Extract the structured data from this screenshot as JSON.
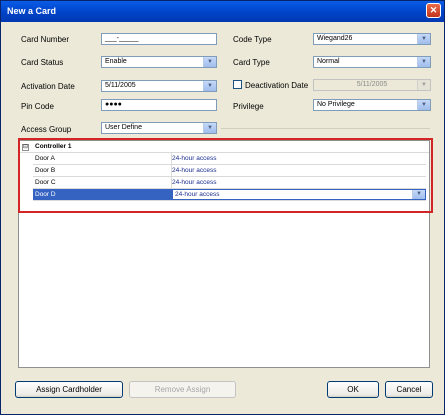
{
  "window": {
    "title": "New a Card",
    "close_glyph": "✕"
  },
  "form": {
    "card_number": {
      "label": "Card Number",
      "value": "___-_____"
    },
    "card_status": {
      "label": "Card Status",
      "value": "Enable"
    },
    "activation_date": {
      "label": "Activation Date",
      "value": "5/11/2005"
    },
    "pin_code": {
      "label": "Pin Code",
      "value": "●●●●"
    },
    "access_group": {
      "label": "Access Group",
      "value": "User Define"
    },
    "code_type": {
      "label": "Code Type",
      "value": "Wiegand26"
    },
    "card_type": {
      "label": "Card Type",
      "value": "Normal"
    },
    "deactivation_date": {
      "label": "Deactivation Date",
      "value": "5/11/2005",
      "checked": false
    },
    "privilege": {
      "label": "Privilege",
      "value": "No Privilege"
    }
  },
  "grid": {
    "expander": "⊟",
    "controller": "Controller 1",
    "rows": [
      {
        "door": "Door A",
        "access": "24-hour access"
      },
      {
        "door": "Door B",
        "access": "24-hour access"
      },
      {
        "door": "Door C",
        "access": "24-hour access"
      },
      {
        "door": "Door D",
        "access": "24-hour access"
      }
    ]
  },
  "buttons": {
    "assign": "Assign Cardholder",
    "remove": "Remove Assign",
    "ok": "OK",
    "cancel": "Cancel"
  },
  "icons": {
    "dropdown": "▼"
  },
  "colors": {
    "titlebar": "#0043C8",
    "selection": "#3563C2",
    "highlight_border": "#D22525",
    "dialog_bg": "#ECE9D8"
  }
}
